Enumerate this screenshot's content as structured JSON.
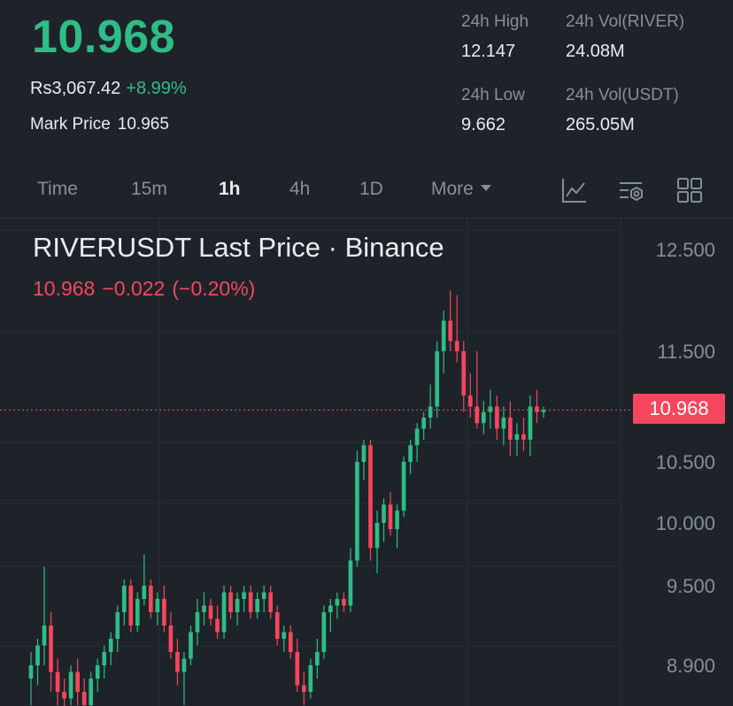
{
  "header": {
    "last_price": "10.968",
    "fiat_price": "Rs3,067.42",
    "change_pct": "+8.99%",
    "mark_label": "Mark Price",
    "mark_value": "10.965"
  },
  "stats": {
    "high_label": "24h High",
    "high_value": "12.147",
    "vol_river_label": "24h Vol(RIVER)",
    "vol_river_value": "24.08M",
    "low_label": "24h Low",
    "low_value": "9.662",
    "vol_usdt_label": "24h Vol(USDT)",
    "vol_usdt_value": "265.05M"
  },
  "tabs": {
    "time": "Time",
    "m15": "15m",
    "h1": "1h",
    "h4": "4h",
    "d1": "1D",
    "more": "More"
  },
  "icons": {
    "indicator": "chart-indicator-icon",
    "settings": "chart-settings-icon",
    "layout": "grid-layout-icon"
  },
  "chart": {
    "title": "RIVERUSDT Last Price · Binance",
    "last": "10.968",
    "change": "−0.022",
    "change_pct": "(−0.20%)",
    "current_tag": "10.968",
    "up_color": "#2ebd85",
    "down_color": "#f6465d"
  },
  "chart_data": {
    "type": "candlestick",
    "ylim": [
      8.7,
      12.7
    ],
    "y_ticks": [
      "12.500",
      "11.500",
      "10.968",
      "10.500",
      "10.000",
      "9.500",
      "8.900"
    ],
    "current_price": 10.968,
    "candles": [
      [
        8.8,
        9.0,
        8.6,
        8.9
      ],
      [
        8.9,
        9.1,
        8.75,
        9.05
      ],
      [
        9.05,
        9.65,
        8.9,
        9.2
      ],
      [
        9.2,
        9.3,
        8.7,
        8.85
      ],
      [
        8.85,
        8.95,
        8.6,
        8.7
      ],
      [
        8.7,
        8.8,
        8.55,
        8.65
      ],
      [
        8.65,
        8.9,
        8.6,
        8.85
      ],
      [
        8.85,
        8.95,
        8.6,
        8.7
      ],
      [
        8.7,
        8.8,
        8.5,
        8.6
      ],
      [
        8.6,
        8.85,
        8.55,
        8.8
      ],
      [
        8.8,
        8.95,
        8.7,
        8.9
      ],
      [
        8.9,
        9.05,
        8.8,
        9.0
      ],
      [
        9.0,
        9.15,
        8.9,
        9.1
      ],
      [
        9.1,
        9.35,
        9.0,
        9.3
      ],
      [
        9.3,
        9.55,
        9.2,
        9.5
      ],
      [
        9.5,
        9.55,
        9.15,
        9.2
      ],
      [
        9.2,
        9.45,
        9.15,
        9.4
      ],
      [
        9.4,
        9.75,
        9.35,
        9.5
      ],
      [
        9.5,
        9.55,
        9.25,
        9.3
      ],
      [
        9.3,
        9.45,
        9.2,
        9.4
      ],
      [
        9.4,
        9.5,
        9.15,
        9.2
      ],
      [
        9.2,
        9.3,
        8.95,
        9.0
      ],
      [
        9.0,
        9.1,
        8.75,
        8.85
      ],
      [
        8.85,
        9.0,
        8.6,
        8.95
      ],
      [
        8.95,
        9.2,
        8.9,
        9.15
      ],
      [
        9.15,
        9.4,
        9.05,
        9.3
      ],
      [
        9.3,
        9.45,
        9.2,
        9.35
      ],
      [
        9.35,
        9.4,
        9.2,
        9.25
      ],
      [
        9.25,
        9.35,
        9.1,
        9.15
      ],
      [
        9.15,
        9.5,
        9.1,
        9.45
      ],
      [
        9.45,
        9.5,
        9.25,
        9.3
      ],
      [
        9.3,
        9.45,
        9.2,
        9.4
      ],
      [
        9.4,
        9.5,
        9.3,
        9.45
      ],
      [
        9.45,
        9.5,
        9.25,
        9.3
      ],
      [
        9.3,
        9.45,
        9.25,
        9.4
      ],
      [
        9.4,
        9.5,
        9.3,
        9.45
      ],
      [
        9.45,
        9.5,
        9.25,
        9.3
      ],
      [
        9.3,
        9.35,
        9.05,
        9.1
      ],
      [
        9.1,
        9.2,
        9.0,
        9.15
      ],
      [
        9.15,
        9.2,
        8.95,
        9.0
      ],
      [
        9.0,
        9.1,
        8.7,
        8.75
      ],
      [
        8.75,
        8.85,
        8.6,
        8.7
      ],
      [
        8.7,
        8.95,
        8.65,
        8.9
      ],
      [
        8.9,
        9.1,
        8.8,
        9.0
      ],
      [
        9.0,
        9.35,
        8.95,
        9.3
      ],
      [
        9.3,
        9.4,
        9.15,
        9.35
      ],
      [
        9.35,
        9.45,
        9.25,
        9.4
      ],
      [
        9.4,
        9.45,
        9.3,
        9.35
      ],
      [
        9.35,
        9.8,
        9.3,
        9.7
      ],
      [
        9.7,
        10.6,
        9.65,
        10.5
      ],
      [
        10.5,
        10.7,
        10.35,
        10.65
      ],
      [
        10.65,
        10.7,
        9.7,
        9.8
      ],
      [
        9.8,
        10.1,
        9.6,
        10.0
      ],
      [
        10.0,
        10.2,
        9.85,
        10.15
      ],
      [
        10.15,
        10.25,
        9.9,
        9.95
      ],
      [
        9.95,
        10.15,
        9.8,
        10.1
      ],
      [
        10.1,
        10.55,
        10.05,
        10.5
      ],
      [
        10.5,
        10.7,
        10.4,
        10.65
      ],
      [
        10.65,
        10.85,
        10.5,
        10.8
      ],
      [
        10.8,
        10.95,
        10.7,
        10.9
      ],
      [
        10.9,
        11.2,
        10.8,
        11.0
      ],
      [
        11.0,
        11.6,
        10.9,
        11.5
      ],
      [
        11.5,
        11.9,
        11.3,
        11.8
      ],
      [
        11.8,
        12.1,
        11.5,
        11.6
      ],
      [
        11.6,
        12.05,
        11.4,
        11.5
      ],
      [
        11.5,
        11.6,
        10.95,
        11.1
      ],
      [
        11.1,
        11.3,
        10.9,
        11.0
      ],
      [
        11.0,
        11.5,
        10.8,
        10.85
      ],
      [
        10.85,
        11.05,
        10.75,
        10.95
      ],
      [
        10.95,
        11.15,
        10.8,
        11.0
      ],
      [
        11.0,
        11.1,
        10.7,
        10.8
      ],
      [
        10.8,
        11.0,
        10.65,
        10.9
      ],
      [
        10.9,
        11.05,
        10.55,
        10.7
      ],
      [
        10.7,
        10.85,
        10.55,
        10.75
      ],
      [
        10.75,
        10.9,
        10.6,
        10.7
      ],
      [
        10.7,
        11.1,
        10.55,
        11.0
      ],
      [
        11.0,
        11.15,
        10.85,
        10.95
      ],
      [
        10.95,
        11.0,
        10.9,
        10.968
      ]
    ]
  }
}
